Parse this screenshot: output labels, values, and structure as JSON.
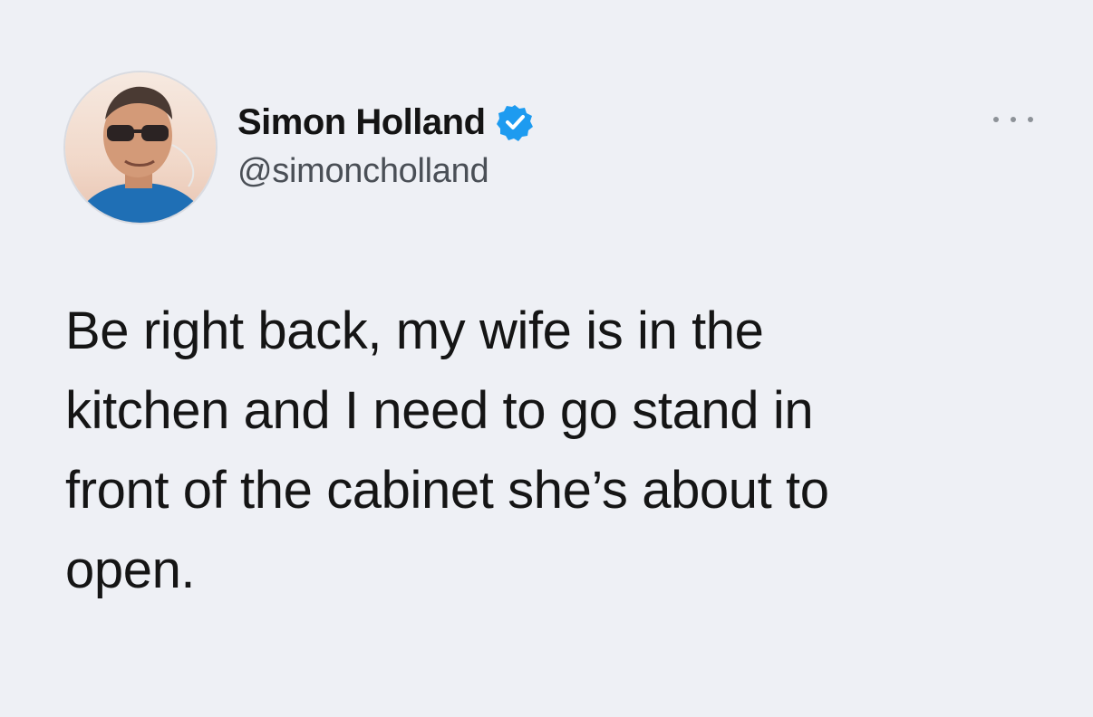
{
  "author": {
    "display_name": "Simon Holland",
    "handle": "@simoncholland",
    "verified": true,
    "verified_badge_color": "#1d9bf0"
  },
  "icons": {
    "verified": "verified-badge-icon",
    "more": "more-options-icon",
    "avatar": "profile-photo"
  },
  "tweet": {
    "text": "Be right back, my wife is in the\nkitchen and I need to go stand in\nfront of the cabinet she’s about to\nopen."
  }
}
